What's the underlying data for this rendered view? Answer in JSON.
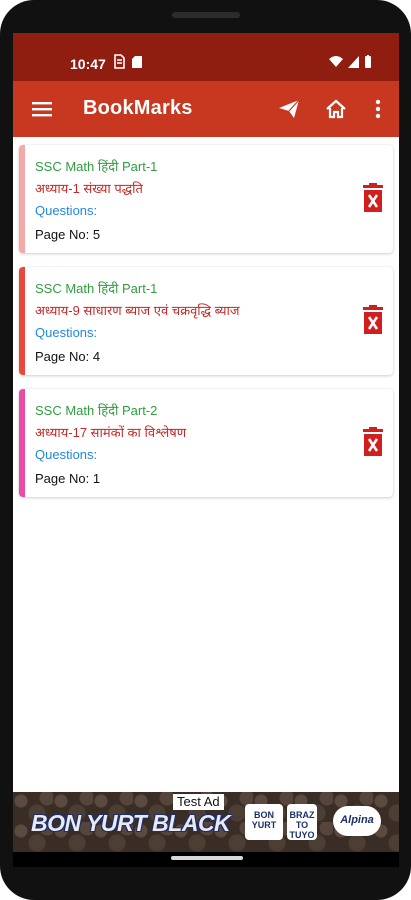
{
  "status_bar": {
    "time": "10:47",
    "left_icons": [
      "sim-icon",
      "sd-card-icon"
    ],
    "right_icons": [
      "wifi-icon",
      "signal-icon",
      "battery-icon"
    ]
  },
  "app_bar": {
    "title": "BookMarks",
    "background": "#c8371f",
    "icons": [
      "menu-icon",
      "send-icon",
      "home-icon",
      "more-vert-icon"
    ]
  },
  "bookmarks": [
    {
      "book": "SSC Math हिंदी Part-1",
      "chapter": "अध्याय-1 संख्या पद्धति",
      "questions": "Questions:",
      "page": "Page No: 5",
      "accent": "#f4a8a8"
    },
    {
      "book": "SSC Math हिंदी Part-1",
      "chapter": "अध्याय-9 साधारण ब्याज एवं चक्रवृद्धि ब्याज",
      "questions": "Questions:",
      "page": "Page No: 4",
      "accent": "#e8493a"
    },
    {
      "book": "SSC Math हिंदी Part-2",
      "chapter": "अध्याय-17 सामंकों का विश्लेषण",
      "questions": "Questions:",
      "page": "Page No: 1",
      "accent": "#ea4ba6"
    }
  ],
  "ad": {
    "label": "Test Ad",
    "brand": "BON YURT BLACK",
    "logo1": "BON YURT",
    "logo2": "BRAZ TO TUYO",
    "logo3": "Alpina"
  }
}
